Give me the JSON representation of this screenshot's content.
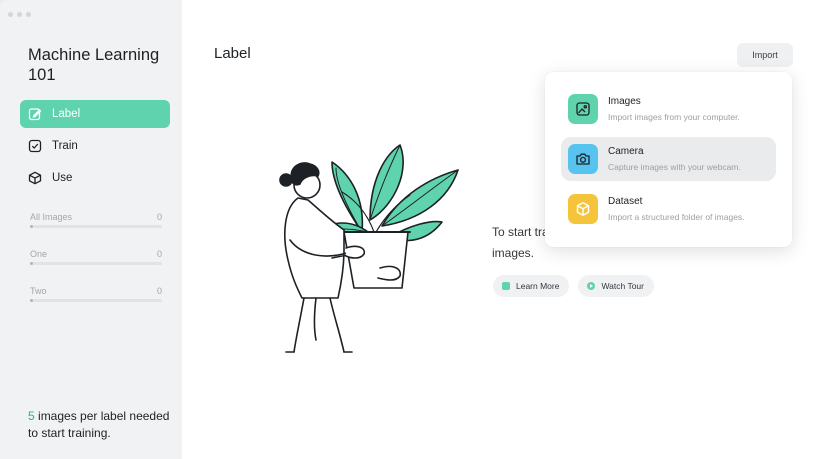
{
  "sidebar": {
    "app_title": "Machine Learning 101",
    "nav": [
      {
        "label": "Label",
        "icon": "edit-icon",
        "active": true
      },
      {
        "label": "Train",
        "icon": "check-square-icon",
        "active": false
      },
      {
        "label": "Use",
        "icon": "cube-icon",
        "active": false
      }
    ],
    "classes": [
      {
        "name": "All Images",
        "count": "0",
        "progress": 0
      },
      {
        "name": "One",
        "count": "0",
        "progress": 0
      },
      {
        "name": "Two",
        "count": "0",
        "progress": 0
      }
    ],
    "footer": {
      "number": "5",
      "text": " images per label needed to start training."
    }
  },
  "main": {
    "title": "Label",
    "import_label": "Import",
    "empty_text": "To start training, import and label some images.",
    "learn_more": "Learn More",
    "watch_tour": "Watch Tour"
  },
  "import_menu": {
    "items": [
      {
        "label": "Images",
        "desc": "Import images from your computer.",
        "icon": "image-icon",
        "color": "#5fd3ad"
      },
      {
        "label": "Camera",
        "desc": "Capture images with your webcam.",
        "icon": "camera-icon",
        "color": "#57c3ef"
      },
      {
        "label": "Dataset",
        "desc": "Import a structured folder of images.",
        "icon": "cube-icon",
        "color": "#f5c43a"
      }
    ]
  },
  "colors": {
    "accent": "#5fd3ad",
    "camera": "#57c3ef",
    "dataset": "#f5c43a"
  }
}
